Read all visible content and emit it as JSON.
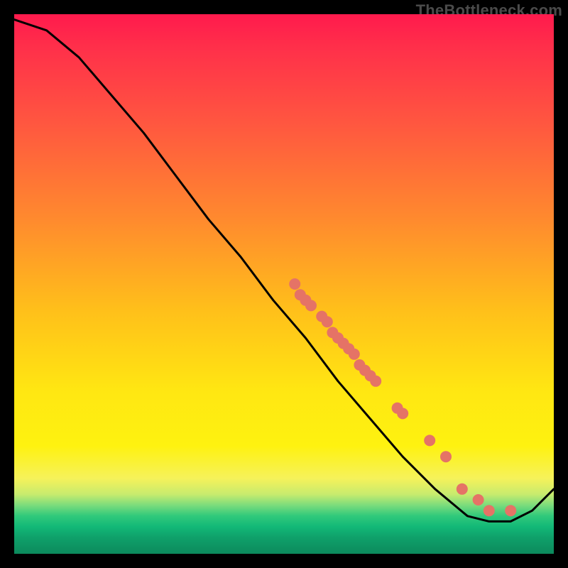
{
  "watermark": "TheBottleneck.com",
  "chart_data": {
    "type": "line",
    "title": "",
    "xlabel": "",
    "ylabel": "",
    "xlim": [
      0,
      100
    ],
    "ylim": [
      0,
      100
    ],
    "grid": false,
    "legend": false,
    "curve": {
      "name": "bottleneck-curve",
      "color": "#000000",
      "points": [
        {
          "x": 0,
          "y": 99
        },
        {
          "x": 6,
          "y": 97
        },
        {
          "x": 12,
          "y": 92
        },
        {
          "x": 18,
          "y": 85
        },
        {
          "x": 24,
          "y": 78
        },
        {
          "x": 30,
          "y": 70
        },
        {
          "x": 36,
          "y": 62
        },
        {
          "x": 42,
          "y": 55
        },
        {
          "x": 48,
          "y": 47
        },
        {
          "x": 54,
          "y": 40
        },
        {
          "x": 60,
          "y": 32
        },
        {
          "x": 66,
          "y": 25
        },
        {
          "x": 72,
          "y": 18
        },
        {
          "x": 78,
          "y": 12
        },
        {
          "x": 84,
          "y": 7
        },
        {
          "x": 88,
          "y": 6
        },
        {
          "x": 92,
          "y": 6
        },
        {
          "x": 96,
          "y": 8
        },
        {
          "x": 100,
          "y": 12
        }
      ]
    },
    "markers": {
      "name": "highlighted-points",
      "color": "#e57366",
      "points": [
        {
          "x": 52,
          "y": 50
        },
        {
          "x": 53,
          "y": 48
        },
        {
          "x": 54,
          "y": 47
        },
        {
          "x": 55,
          "y": 46
        },
        {
          "x": 57,
          "y": 44
        },
        {
          "x": 58,
          "y": 43
        },
        {
          "x": 59,
          "y": 41
        },
        {
          "x": 60,
          "y": 40
        },
        {
          "x": 61,
          "y": 39
        },
        {
          "x": 62,
          "y": 38
        },
        {
          "x": 63,
          "y": 37
        },
        {
          "x": 64,
          "y": 35
        },
        {
          "x": 65,
          "y": 34
        },
        {
          "x": 66,
          "y": 33
        },
        {
          "x": 67,
          "y": 32
        },
        {
          "x": 71,
          "y": 27
        },
        {
          "x": 72,
          "y": 26
        },
        {
          "x": 77,
          "y": 21
        },
        {
          "x": 80,
          "y": 18
        },
        {
          "x": 83,
          "y": 12
        },
        {
          "x": 86,
          "y": 10
        },
        {
          "x": 88,
          "y": 8
        },
        {
          "x": 92,
          "y": 8
        }
      ]
    }
  }
}
